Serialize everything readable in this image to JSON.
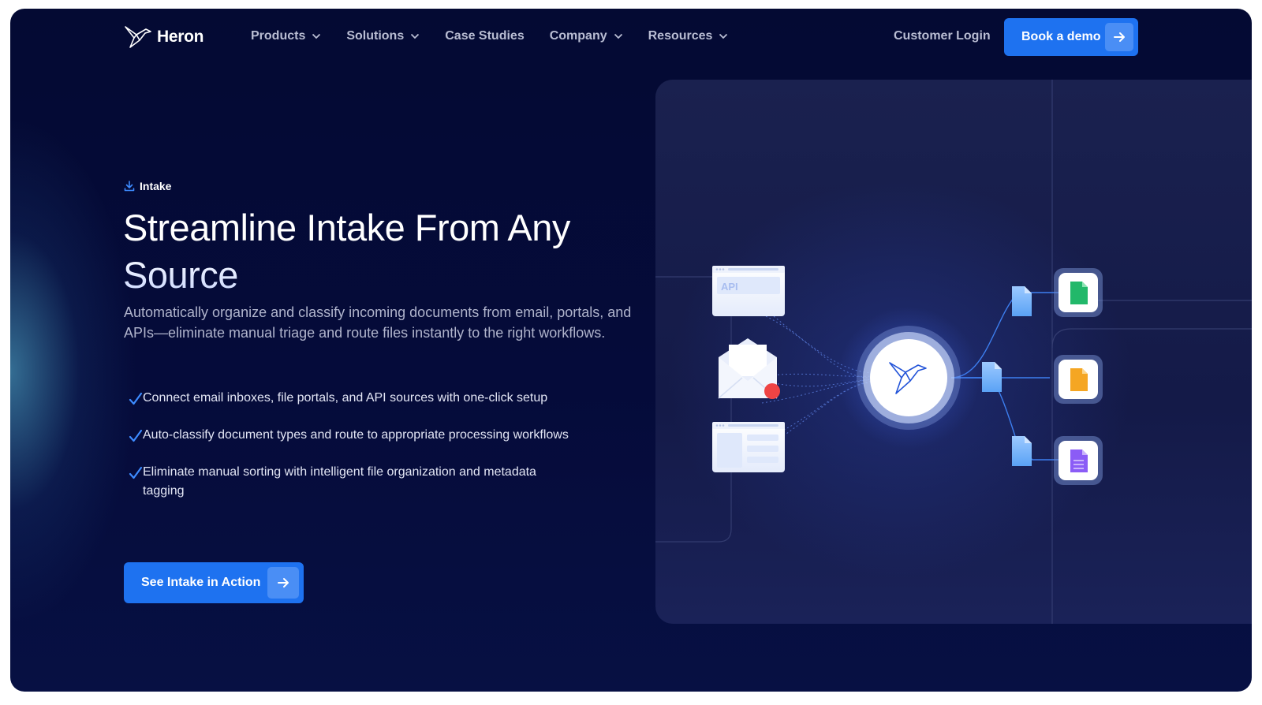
{
  "brand": {
    "name": "Heron"
  },
  "nav": {
    "items": [
      {
        "label": "Products",
        "dropdown": true
      },
      {
        "label": "Solutions",
        "dropdown": true
      },
      {
        "label": "Case Studies",
        "dropdown": false
      },
      {
        "label": "Company",
        "dropdown": true
      },
      {
        "label": "Resources",
        "dropdown": true
      }
    ],
    "login_label": "Customer Login",
    "demo_label": "Book a demo"
  },
  "hero": {
    "eyebrow": "Intake",
    "title": "Streamline Intake From Any Source",
    "subtitle": "Automatically organize and classify incoming documents from email, portals, and APIs—eliminate manual triage and route files instantly to the right workflows.",
    "bullets": [
      "Connect email inboxes, file portals, and API sources with one-click setup",
      "Auto-classify document types and route to appropriate processing workflows",
      "Eliminate manual sorting with intelligent file organization and metadata tagging"
    ],
    "cta_label": "See Intake in Action"
  },
  "illustration": {
    "api_label": "API",
    "output_colors": [
      "#22b86a",
      "#f5a623",
      "#8b5cf6"
    ]
  },
  "colors": {
    "background": "#050b3a",
    "accent": "#1e72f0",
    "accent_light": "#4a8ef5",
    "notification": "#ef4444"
  }
}
